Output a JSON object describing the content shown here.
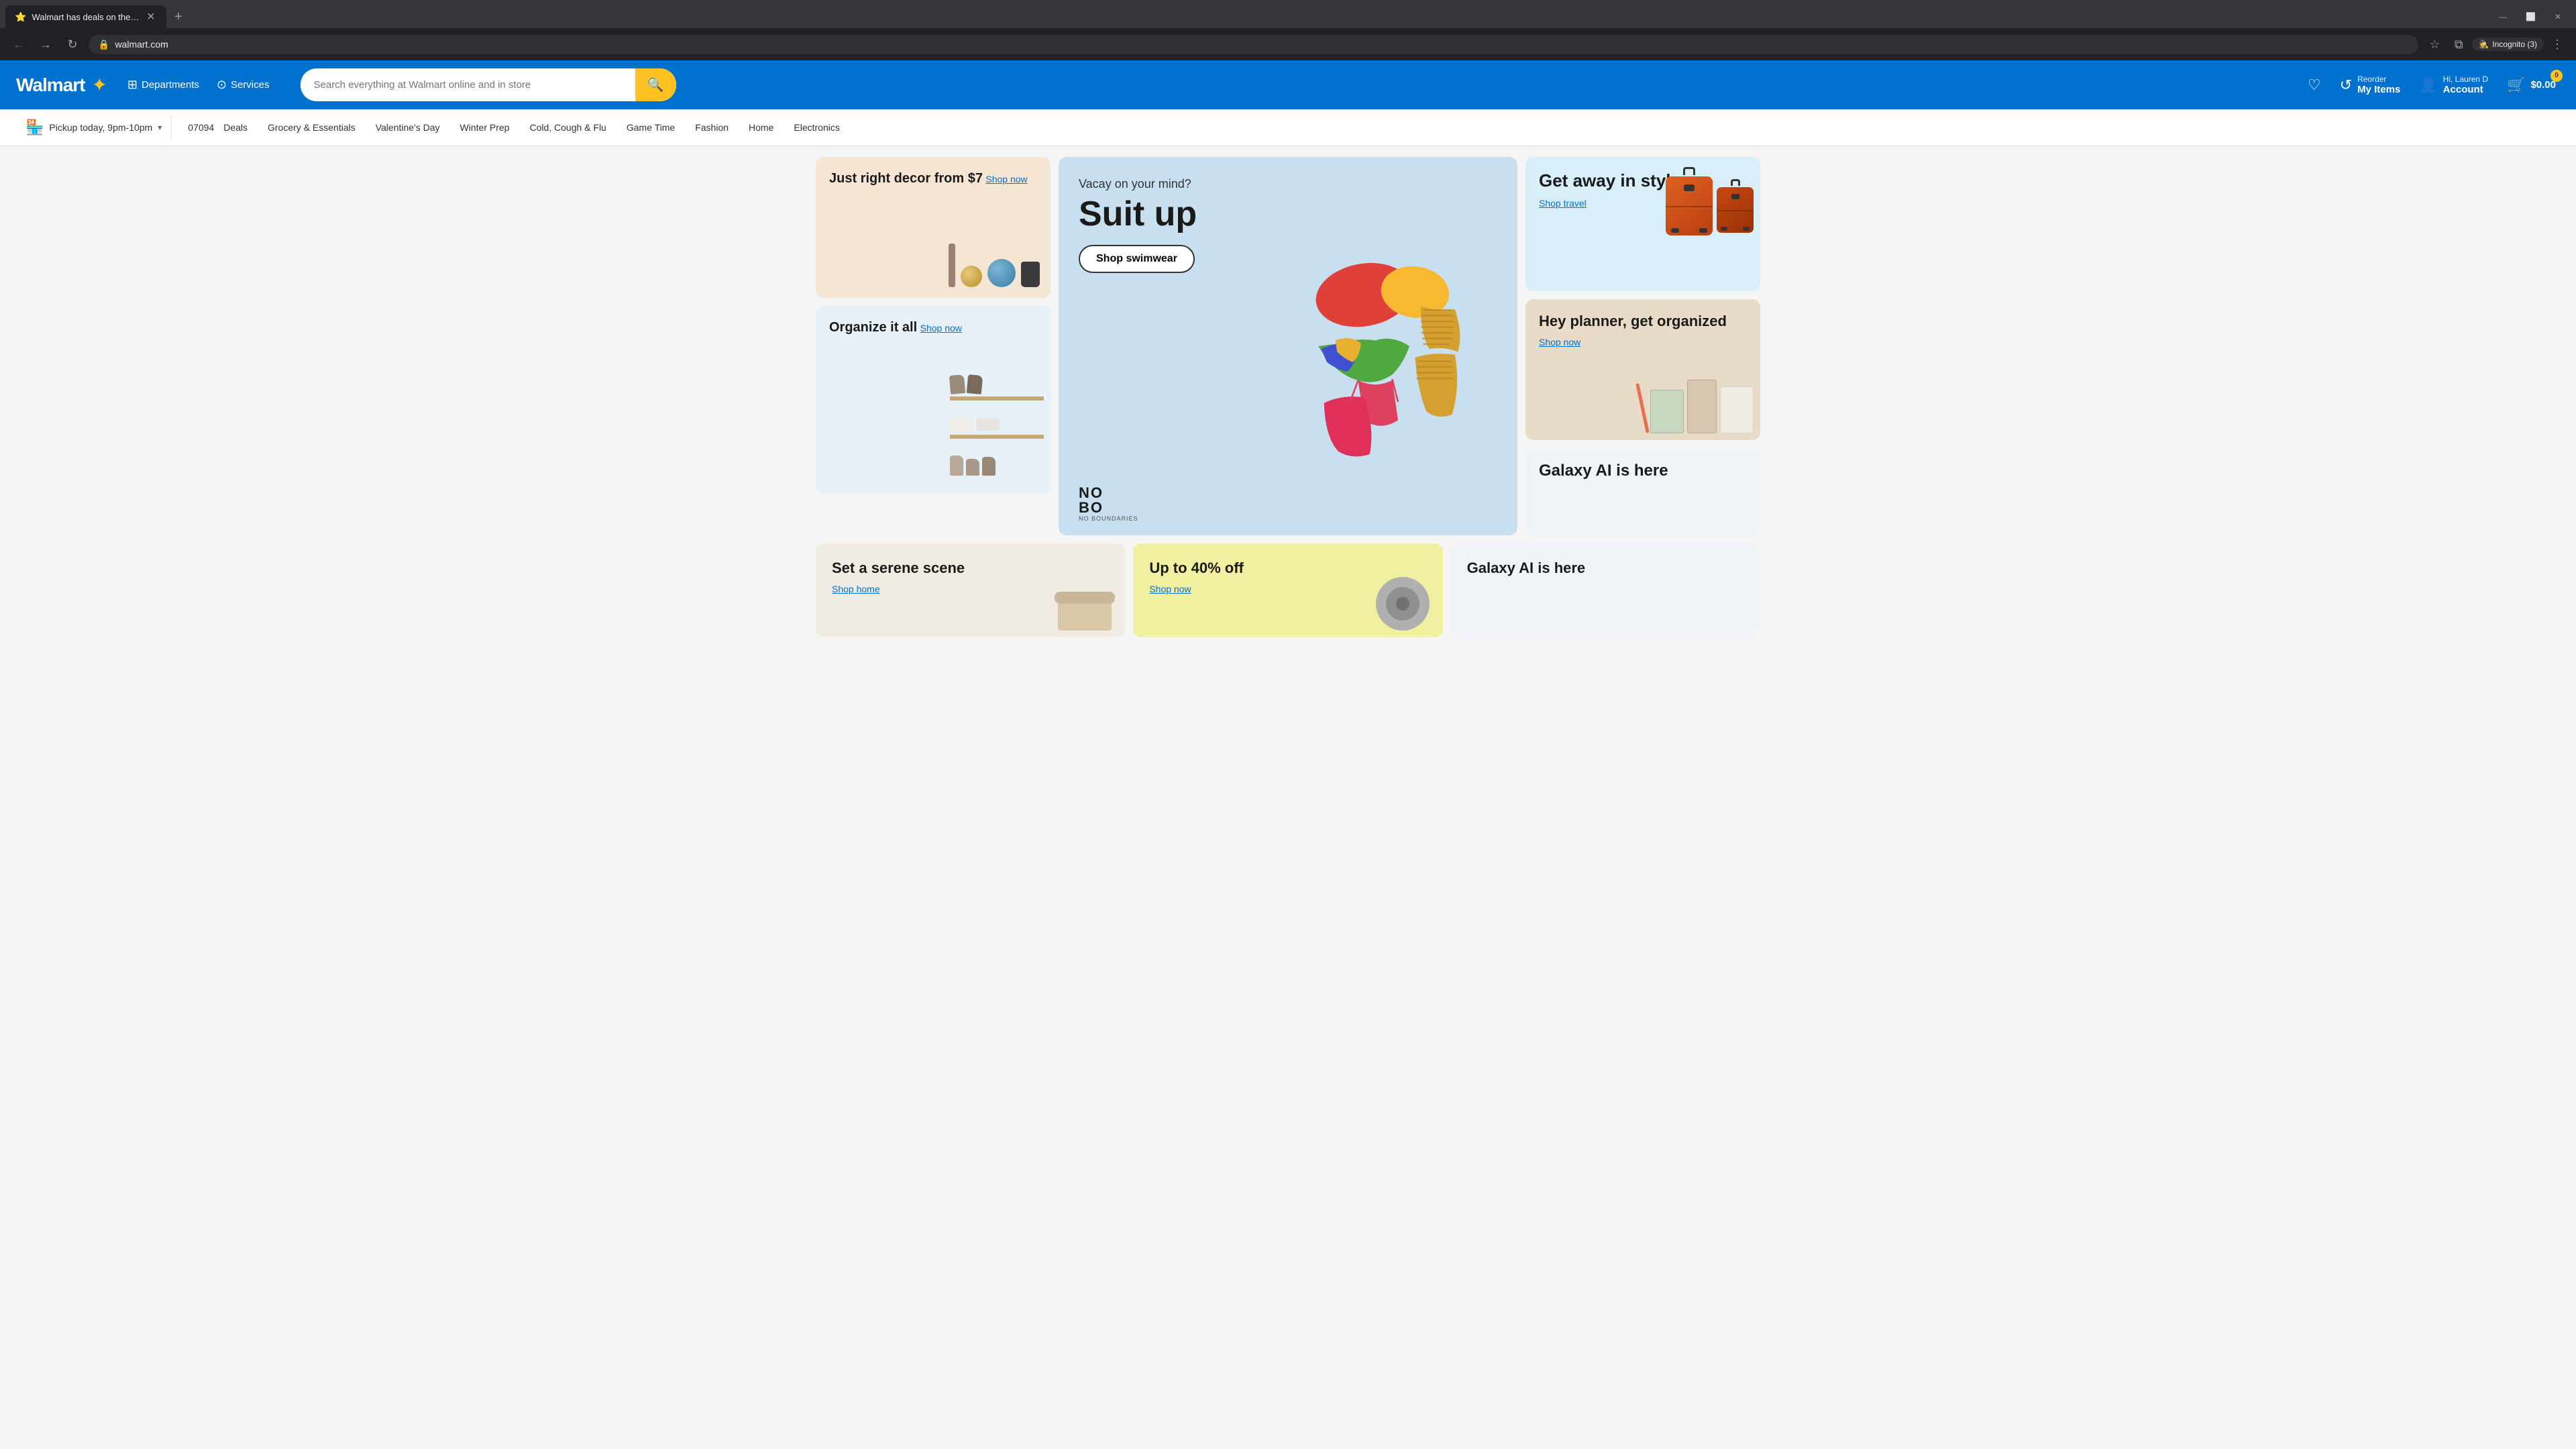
{
  "browser": {
    "tab": {
      "favicon": "⭐",
      "title": "Walmart has deals on the most...",
      "url": "walmart.com"
    },
    "incognito": "Incognito (3)"
  },
  "header": {
    "logo": "Walmart",
    "spark": "✦",
    "nav": {
      "departments": "Departments",
      "services": "Services"
    },
    "search": {
      "placeholder": "Search everything at Walmart online and in store"
    },
    "reorder": {
      "label": "Reorder",
      "title": "My Items"
    },
    "account": {
      "greeting": "Hi, Lauren D",
      "title": "Account"
    },
    "cart": {
      "count": "0",
      "amount": "$0.00"
    }
  },
  "subnav": {
    "pickup": "Pickup today, 9pm-10pm",
    "zipcode": "07094",
    "links": [
      "Deals",
      "Grocery & Essentials",
      "Valentine's Day",
      "Winter Prep",
      "Cold, Cough & Flu",
      "Game Time",
      "Fashion",
      "Home",
      "Electronics"
    ]
  },
  "hero": {
    "subtitle": "Vacay on your mind?",
    "title": "Suit up",
    "cta": "Shop swimwear",
    "brand": "NO BOUNDARIES",
    "brand_sub": "NO BO"
  },
  "promo": {
    "decor": {
      "title": "Just right decor from $7",
      "link": "Shop now"
    },
    "organize": {
      "title": "Organize it all",
      "link": "Shop now"
    },
    "travel": {
      "title": "Get away in style",
      "link": "Shop travel"
    },
    "planner": {
      "title": "Hey planner, get organized",
      "link": "Shop now"
    },
    "serene": {
      "title": "Set a serene scene",
      "link": "Shop home"
    },
    "discount": {
      "title": "Up to 40% off",
      "link": "Shop now"
    },
    "galaxy": {
      "title": "Galaxy AI is here"
    }
  },
  "icons": {
    "back": "←",
    "forward": "→",
    "reload": "↻",
    "star": "☆",
    "profile": "◉",
    "menu": "⋮",
    "search": "🔍",
    "cart": "🛒",
    "account": "👤",
    "heart": "♡",
    "pickup": "🏪",
    "chevron_down": "▾",
    "grid": "⊞"
  }
}
